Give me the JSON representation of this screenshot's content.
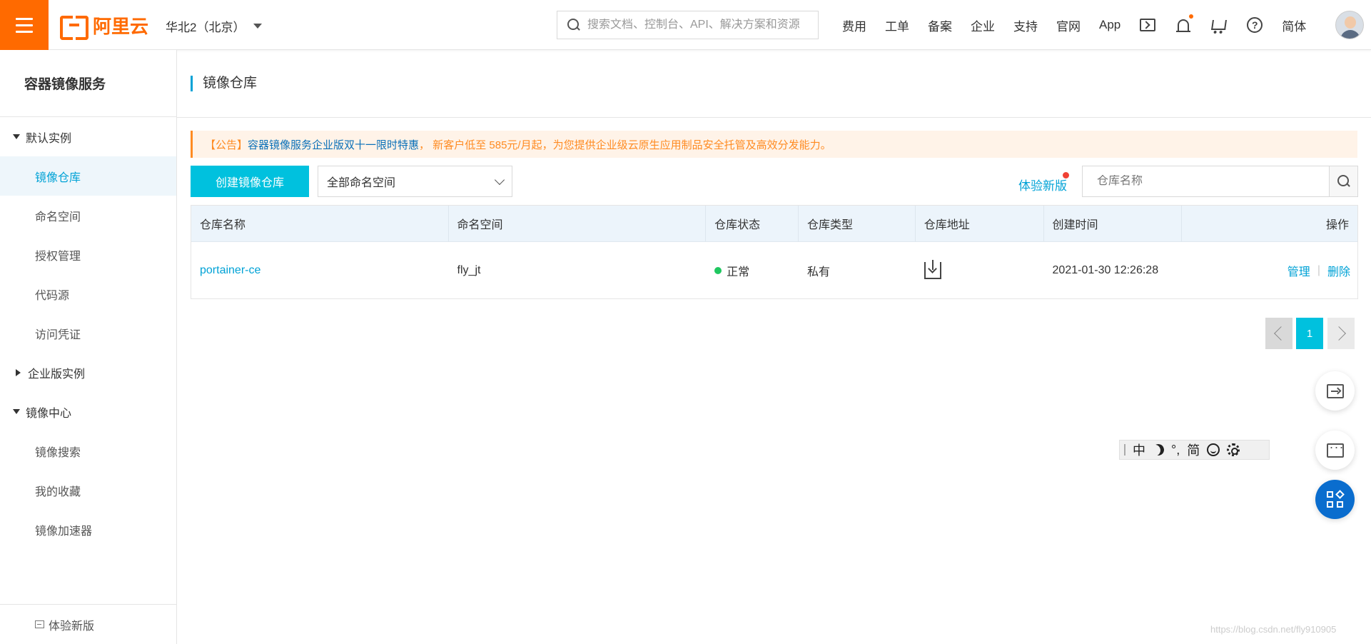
{
  "topbar": {
    "brand": "阿里云",
    "region": "华北2（北京）",
    "search_placeholder": "搜索文档、控制台、API、解决方案和资源",
    "nav": [
      "费用",
      "工单",
      "备案",
      "企业",
      "支持",
      "官网",
      "App"
    ],
    "language": "简体",
    "brand_color": "#ff6a00"
  },
  "sidebar": {
    "title": "容器镜像服务",
    "groups": [
      {
        "label": "默认实例",
        "expanded": true,
        "items": [
          "镜像仓库",
          "命名空间",
          "授权管理",
          "代码源",
          "访问凭证"
        ]
      },
      {
        "label": "企业版实例",
        "expanded": false,
        "items": []
      },
      {
        "label": "镜像中心",
        "expanded": true,
        "items": [
          "镜像搜索",
          "我的收藏",
          "镜像加速器"
        ]
      }
    ],
    "active_item": "镜像仓库",
    "footer": "体验新版"
  },
  "main": {
    "page_title": "镜像仓库",
    "notice": {
      "prefix": "【公告】",
      "highlight1": "容器镜像服务企业版",
      "highlight2": "双十一限时特惠",
      "rest": "， 新客户低至 585元/月起，为您提供企业级云原生应用制品安全托管及高效分发能力。"
    },
    "create_button": "创建镜像仓库",
    "namespace_select": "全部命名空间",
    "try_new": "体验新版",
    "repo_search_placeholder": "仓库名称",
    "table": {
      "columns": [
        "仓库名称",
        "命名空间",
        "仓库状态",
        "仓库类型",
        "仓库地址",
        "创建时间",
        "操作"
      ],
      "rows": [
        {
          "name": "portainer-ce",
          "namespace": "fly_jt",
          "status": "正常",
          "type": "私有",
          "created": "2021-01-30 12:26:28",
          "op_manage": "管理",
          "op_separator": "|",
          "op_delete": "删除"
        }
      ]
    },
    "pagination": {
      "current": "1"
    }
  },
  "ime": {
    "mode": "中",
    "punct": "°,",
    "charset": "简"
  },
  "watermark": "https://blog.csdn.net/fly910905",
  "colors": {
    "accent": "#00c1de",
    "link": "#00a2d6",
    "notice": "#ff8b22",
    "status_ok": "#1fc760"
  }
}
